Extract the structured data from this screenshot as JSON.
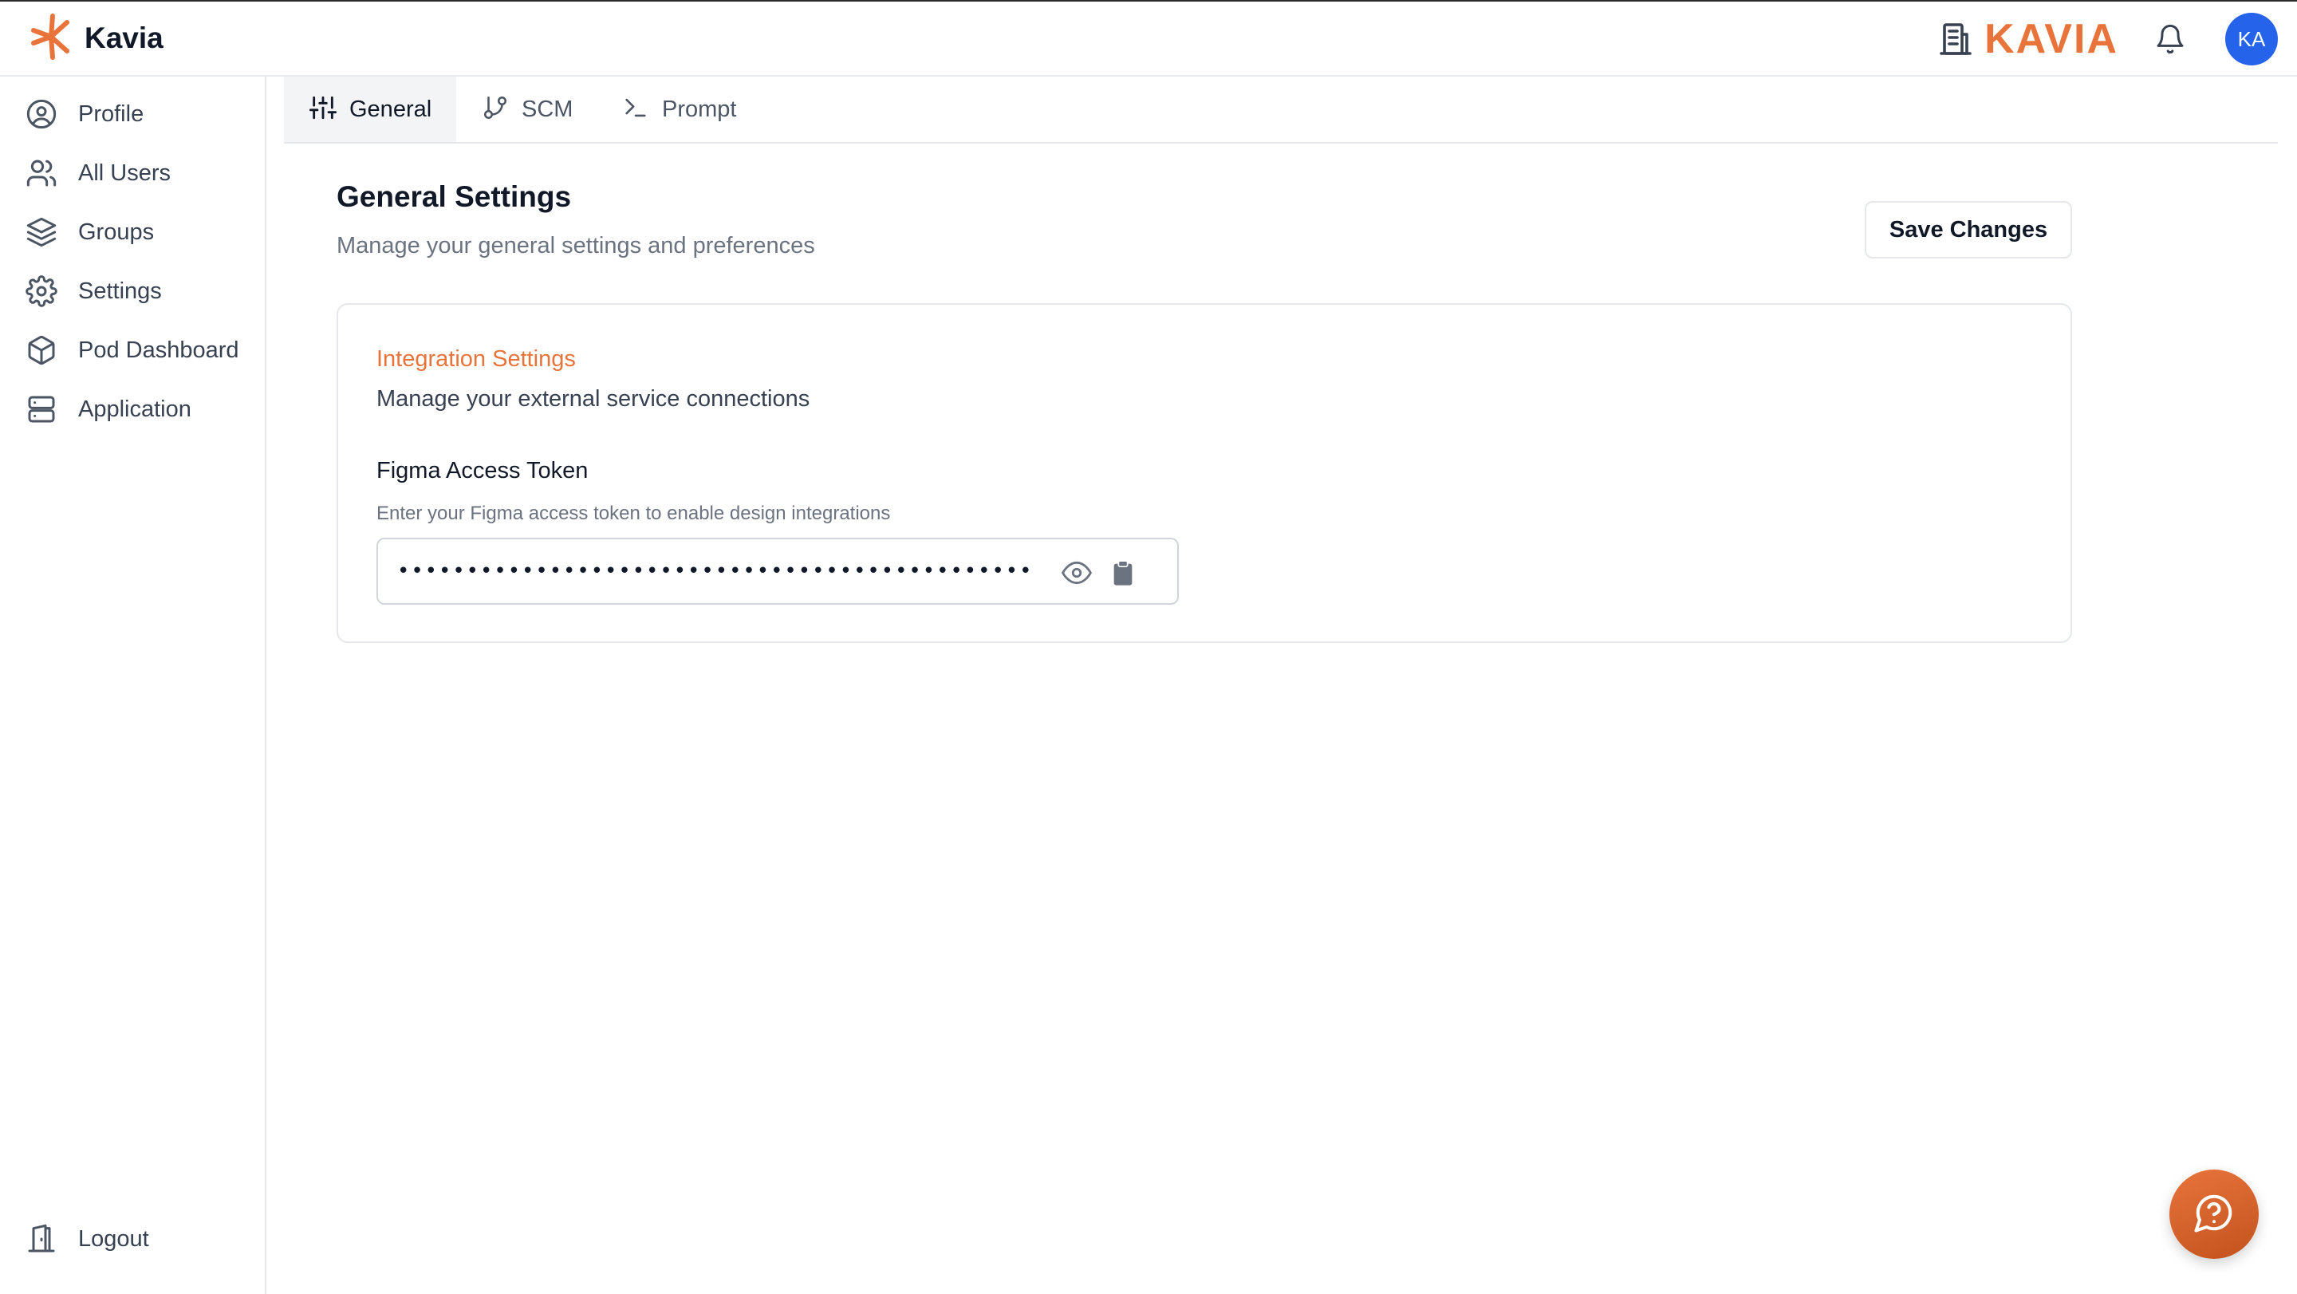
{
  "app": {
    "brand_name": "Kavia",
    "org_name": "KAVIA",
    "avatar_initials": "KA",
    "accent_color": "#e8743b"
  },
  "sidebar": {
    "items": [
      {
        "label": "Profile",
        "icon": "user-circle-icon"
      },
      {
        "label": "All Users",
        "icon": "users-icon"
      },
      {
        "label": "Groups",
        "icon": "layers-icon"
      },
      {
        "label": "Settings",
        "icon": "gear-icon"
      },
      {
        "label": "Pod Dashboard",
        "icon": "cube-icon"
      },
      {
        "label": "Application",
        "icon": "server-icon"
      }
    ],
    "logout_label": "Logout"
  },
  "tabs": [
    {
      "label": "General",
      "icon": "sliders-icon",
      "active": true
    },
    {
      "label": "SCM",
      "icon": "git-branch-icon",
      "active": false
    },
    {
      "label": "Prompt",
      "icon": "terminal-icon",
      "active": false
    }
  ],
  "main": {
    "title": "General Settings",
    "subtitle": "Manage your general settings and preferences",
    "save_label": "Save Changes"
  },
  "integration": {
    "title": "Integration Settings",
    "description": "Manage your external service connections",
    "figma_label": "Figma Access Token",
    "figma_help": "Enter your Figma access token to enable design integrations",
    "token_masked": "••••••••••••••••••••••••••••••••••••••••••••••••••"
  }
}
